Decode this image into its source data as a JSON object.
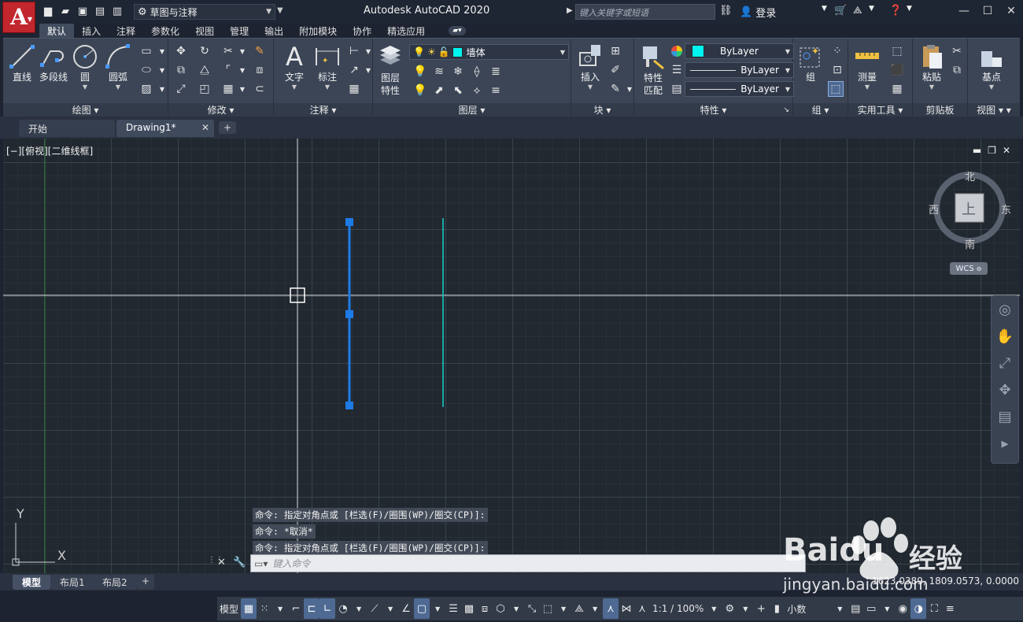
{
  "titlebar": {
    "workspace": "草图与注释",
    "app_title": "Autodesk AutoCAD 2020",
    "search_placeholder": "键入关键字或短语",
    "signin": "登录"
  },
  "ribbon_tabs": [
    "默认",
    "插入",
    "注释",
    "参数化",
    "视图",
    "管理",
    "输出",
    "附加模块",
    "协作",
    "精选应用"
  ],
  "panels": {
    "draw": {
      "title": "绘图",
      "line": "直线",
      "polyline": "多段线",
      "circle": "圆",
      "arc": "圆弧"
    },
    "modify": {
      "title": "修改"
    },
    "annotation": {
      "title": "注释",
      "text": "文字",
      "dimension": "标注"
    },
    "layers": {
      "title": "图层",
      "layer_props_1": "图层",
      "layer_props_2": "特性",
      "current_layer": "墙体"
    },
    "block": {
      "title": "块",
      "insert": "插入"
    },
    "properties": {
      "title": "特性",
      "match_1": "特性",
      "match_2": "匹配",
      "color": "ByLayer",
      "linetype": "ByLayer",
      "lineweight": "ByLayer"
    },
    "groups": {
      "title": "组",
      "group": "组"
    },
    "utilities": {
      "title": "实用工具",
      "measure": "测量"
    },
    "clipboard": {
      "title": "剪贴板",
      "paste": "粘贴"
    },
    "view": {
      "title": "视图",
      "base": "基点"
    }
  },
  "doc_tabs": {
    "start": "开始",
    "drawing": "Drawing1*"
  },
  "viewport": {
    "label": "[−][俯视][二维线框]",
    "viewcube": {
      "north": "北",
      "south": "南",
      "east": "东",
      "west": "西",
      "top": "上"
    },
    "wcs": "WCS"
  },
  "ucs": {
    "x": "X",
    "y": "Y"
  },
  "command": {
    "history": [
      "命令: 指定对角点或 [栏选(F)/圈围(WP)/圈交(CP)]:",
      "命令: *取消*",
      "命令: 指定对角点或 [栏选(F)/圈围(WP)/圈交(CP)]:"
    ],
    "placeholder": "键入命令"
  },
  "layout_tabs": [
    "模型",
    "布局1",
    "布局2"
  ],
  "coordinates": "1623.0389, 1809.0573, 0.0000",
  "statusbar": {
    "model": "模型",
    "scale": "1:1 / 100%",
    "units": "小数"
  },
  "watermark": {
    "brand": "Baidu",
    "product": "经验",
    "url": "jingyan.baidu.com"
  },
  "colors": {
    "accent_blue": "#1e7be6",
    "cyan_line": "#18c9c4",
    "app_red": "#c1272d",
    "crosshair": "#ffffff"
  }
}
